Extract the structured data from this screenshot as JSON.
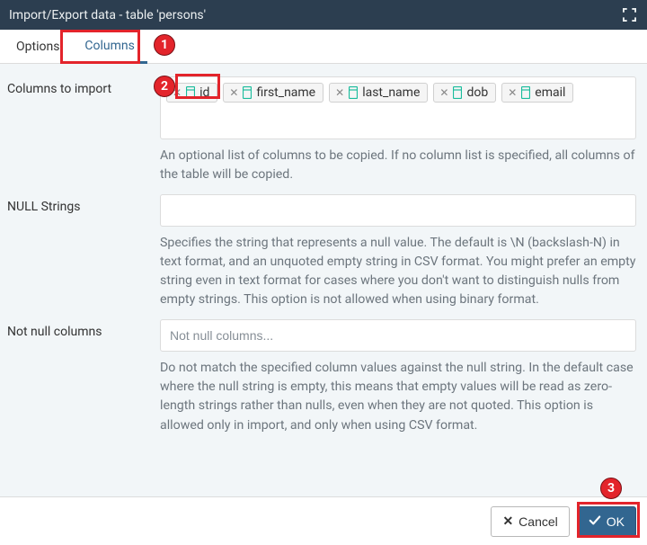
{
  "titlebar": {
    "title": "Import/Export data - table 'persons'"
  },
  "tabs": {
    "options": "Options",
    "columns": "Columns",
    "active": "columns"
  },
  "fields": {
    "columns_to_import": {
      "label": "Columns to import",
      "tags": [
        "id",
        "first_name",
        "last_name",
        "dob",
        "email"
      ],
      "help": "An optional list of columns to be copied. If no column list is specified, all columns of the table will be copied."
    },
    "null_strings": {
      "label": "NULL Strings",
      "value": "",
      "help": "Specifies the string that represents a null value. The default is \\N (backslash-N) in text format, and an unquoted empty string in CSV format. You might prefer an empty string even in text format for cases where you don't want to distinguish nulls from empty strings. This option is not allowed when using binary format."
    },
    "not_null_columns": {
      "label": "Not null columns",
      "placeholder": "Not null columns...",
      "help": "Do not match the specified column values against the null string. In the default case where the null string is empty, this means that empty values will be read as zero-length strings rather than nulls, even when they are not quoted. This option is allowed only in import, and only when using CSV format."
    }
  },
  "footer": {
    "cancel": "Cancel",
    "ok": "OK"
  },
  "annotations": {
    "step1": "1",
    "step2": "2",
    "step3": "3"
  }
}
